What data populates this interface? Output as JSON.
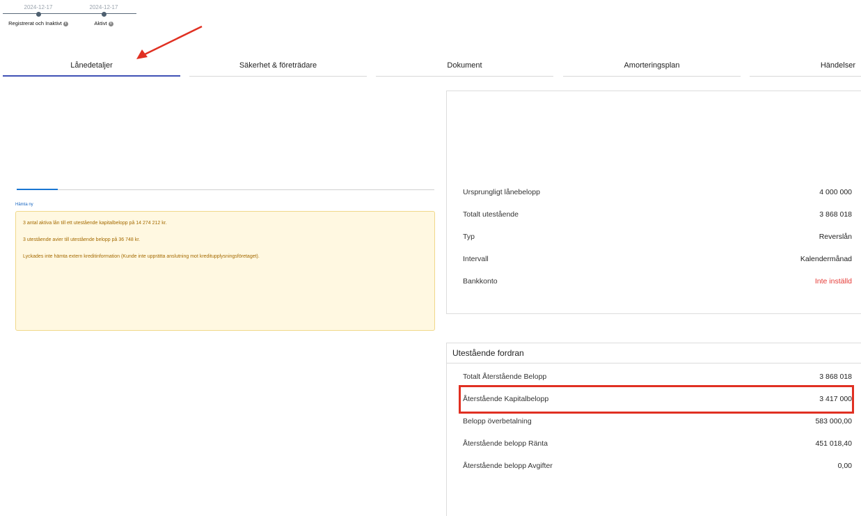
{
  "stepper": {
    "steps": [
      {
        "date": "2024-12-17",
        "label": "Registrerat och Inaktivt"
      },
      {
        "date": "2024-12-17",
        "label": "Aktivt"
      }
    ],
    "info_icon": "i"
  },
  "tabs": [
    {
      "label": "Lånedetaljer",
      "active": true
    },
    {
      "label": "Säkerhet & företrädare",
      "active": false
    },
    {
      "label": "Dokument",
      "active": false
    },
    {
      "label": "Amorteringsplan",
      "active": false
    },
    {
      "label": "Händelser",
      "active": false
    }
  ],
  "left": {
    "fetch_link": "Hämta ny",
    "alert_lines": [
      "3 antal aktiva lån till ett utestående kapitalbelopp på 14 274 212 kr.",
      "3 utestående avier till utestående belopp på 36 748 kr.",
      "Lyckades inte hämta extern kreditinformation (Kunde inte upprätta anslutning mot kreditupplysningsföretaget)."
    ]
  },
  "loan_info": {
    "rows": [
      {
        "label": "Ursprungligt lånebelopp",
        "value": "4 000 000"
      },
      {
        "label": "Totalt utestående",
        "value": "3 868 018"
      },
      {
        "label": "Typ",
        "value": "Reverslån"
      },
      {
        "label": "Intervall",
        "value": "Kalendermånad"
      },
      {
        "label": "Bankkonto",
        "value": "Inte inställd"
      }
    ]
  },
  "outstanding": {
    "title": "Utestående fordran",
    "rows": [
      {
        "label": "Totalt Återstående Belopp",
        "value": "3 868 018"
      },
      {
        "label": "Återstående Kapitalbelopp",
        "value": "3 417 000"
      },
      {
        "label": "Belopp överbetalning",
        "value": "583 000,00"
      },
      {
        "label": "Återstående belopp Ränta",
        "value": "451 018,40"
      },
      {
        "label": "Återstående belopp Avgifter",
        "value": "0,00"
      }
    ]
  },
  "colors": {
    "active_tab": "#3f51b5",
    "warning_text": "#a46a00",
    "warning_bg": "#fff8e1",
    "error_text": "#e53935",
    "annotation": "#e03022"
  }
}
